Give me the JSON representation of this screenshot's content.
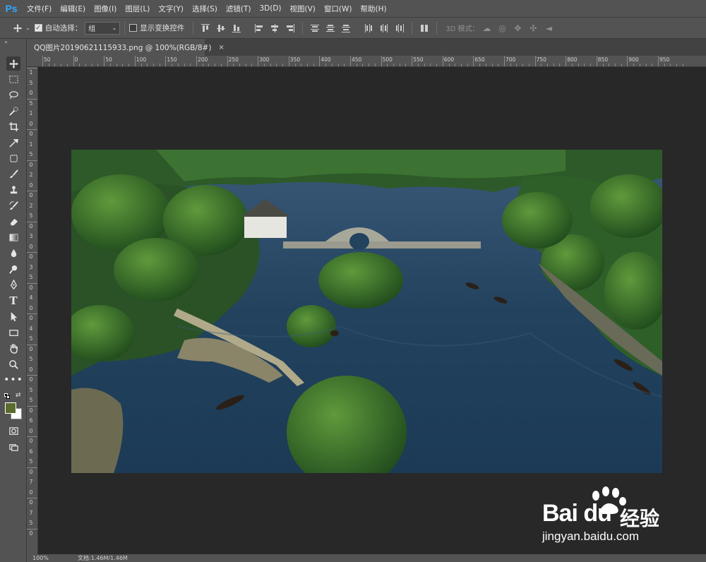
{
  "app": {
    "logo": "Ps"
  },
  "menu": [
    "文件(F)",
    "编辑(E)",
    "图像(I)",
    "图层(L)",
    "文字(Y)",
    "选择(S)",
    "滤镜(T)",
    "3D(D)",
    "视图(V)",
    "窗口(W)",
    "帮助(H)"
  ],
  "options": {
    "auto_select_label": "自动选择：",
    "auto_select_checked": true,
    "group_value": "组",
    "show_transform_label": "显示变换控件",
    "show_transform_checked": false,
    "mode3d_label": "3D 模式："
  },
  "tab": {
    "title": "QQ图片20190621115933.png @ 100%(RGB/8#)",
    "close": "×"
  },
  "ruler_top": [
    "50",
    "0",
    "50",
    "100",
    "150",
    "200",
    "250",
    "300",
    "350",
    "400",
    "450",
    "500",
    "550",
    "600",
    "650",
    "700",
    "750",
    "800",
    "850",
    "900",
    "950"
  ],
  "ruler_left": [
    "1",
    "5",
    "0",
    "5",
    "1",
    "0",
    "0",
    "1",
    "5",
    "0",
    "2",
    "0",
    "0",
    "2",
    "5",
    "0",
    "3",
    "0",
    "0",
    "3",
    "5",
    "0",
    "4",
    "0",
    "0",
    "4",
    "5",
    "0",
    "5",
    "0",
    "0",
    "5",
    "5",
    "0",
    "6",
    "0",
    "0",
    "6",
    "5",
    "0",
    "7",
    "0",
    "0",
    "7",
    "5",
    "0"
  ],
  "status": {
    "zoom": "100%",
    "doc": "文档:1.46M/1.46M"
  },
  "watermark": {
    "brand": "Bai du",
    "cn": "经验",
    "url": "jingyan.baidu.com"
  },
  "colors": {
    "foreground": "#5a6b2e",
    "background": "#ffffff",
    "accent": "#31a8ff"
  }
}
